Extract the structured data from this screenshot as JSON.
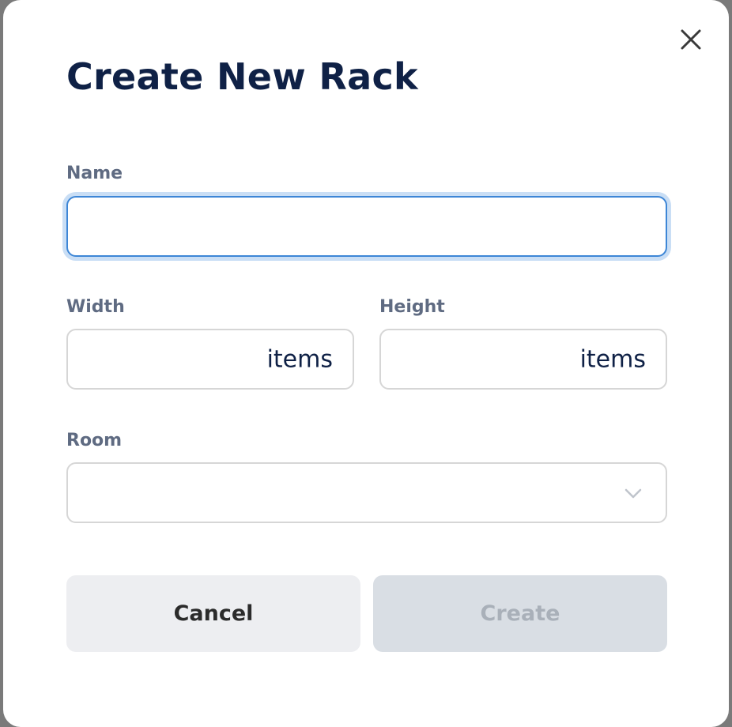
{
  "dialog": {
    "title": "Create New Rack",
    "close_icon": "close-icon"
  },
  "form": {
    "name": {
      "label": "Name",
      "value": ""
    },
    "width": {
      "label": "Width",
      "value": "",
      "unit": "items"
    },
    "height": {
      "label": "Height",
      "value": "",
      "unit": "items"
    },
    "room": {
      "label": "Room",
      "selected": "",
      "icon": "chevron-down-icon"
    }
  },
  "actions": {
    "cancel_label": "Cancel",
    "create_label": "Create"
  },
  "colors": {
    "title": "#0f2146",
    "label": "#5f6b82",
    "focus_border": "#3d86d6",
    "focus_ring": "#c9def5",
    "cancel_bg": "#edeef1",
    "create_disabled_bg": "#d9dee4",
    "create_disabled_text": "#a9b0b9"
  }
}
